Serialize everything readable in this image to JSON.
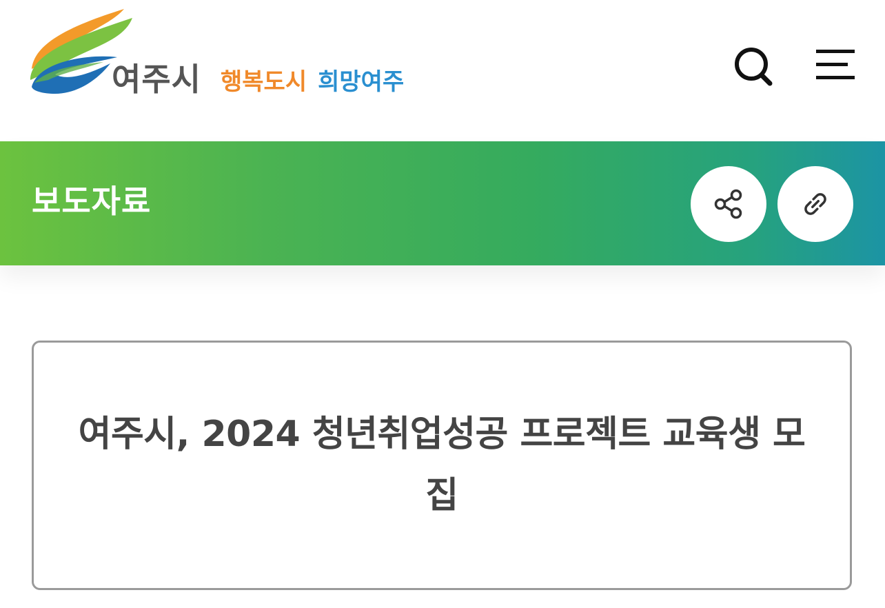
{
  "header": {
    "logo": {
      "city_name": "여주시",
      "slogan_part1": "행복도시",
      "slogan_part2": "희망여주",
      "colors": {
        "orange": "#f0892a",
        "green": "#7cc242",
        "blue": "#1f6fb5",
        "text_gray": "#555555"
      }
    },
    "search_icon": "search-icon",
    "menu_icon": "hamburger-menu-icon"
  },
  "banner": {
    "title": "보도자료",
    "share_icon": "share-icon",
    "link_icon": "link-icon",
    "gradient": [
      "#6cc23f",
      "#35ab5e",
      "#1c94a4"
    ]
  },
  "article": {
    "title": "여주시, 2024 청년취업성공 프로젝트 교육생 모집"
  }
}
